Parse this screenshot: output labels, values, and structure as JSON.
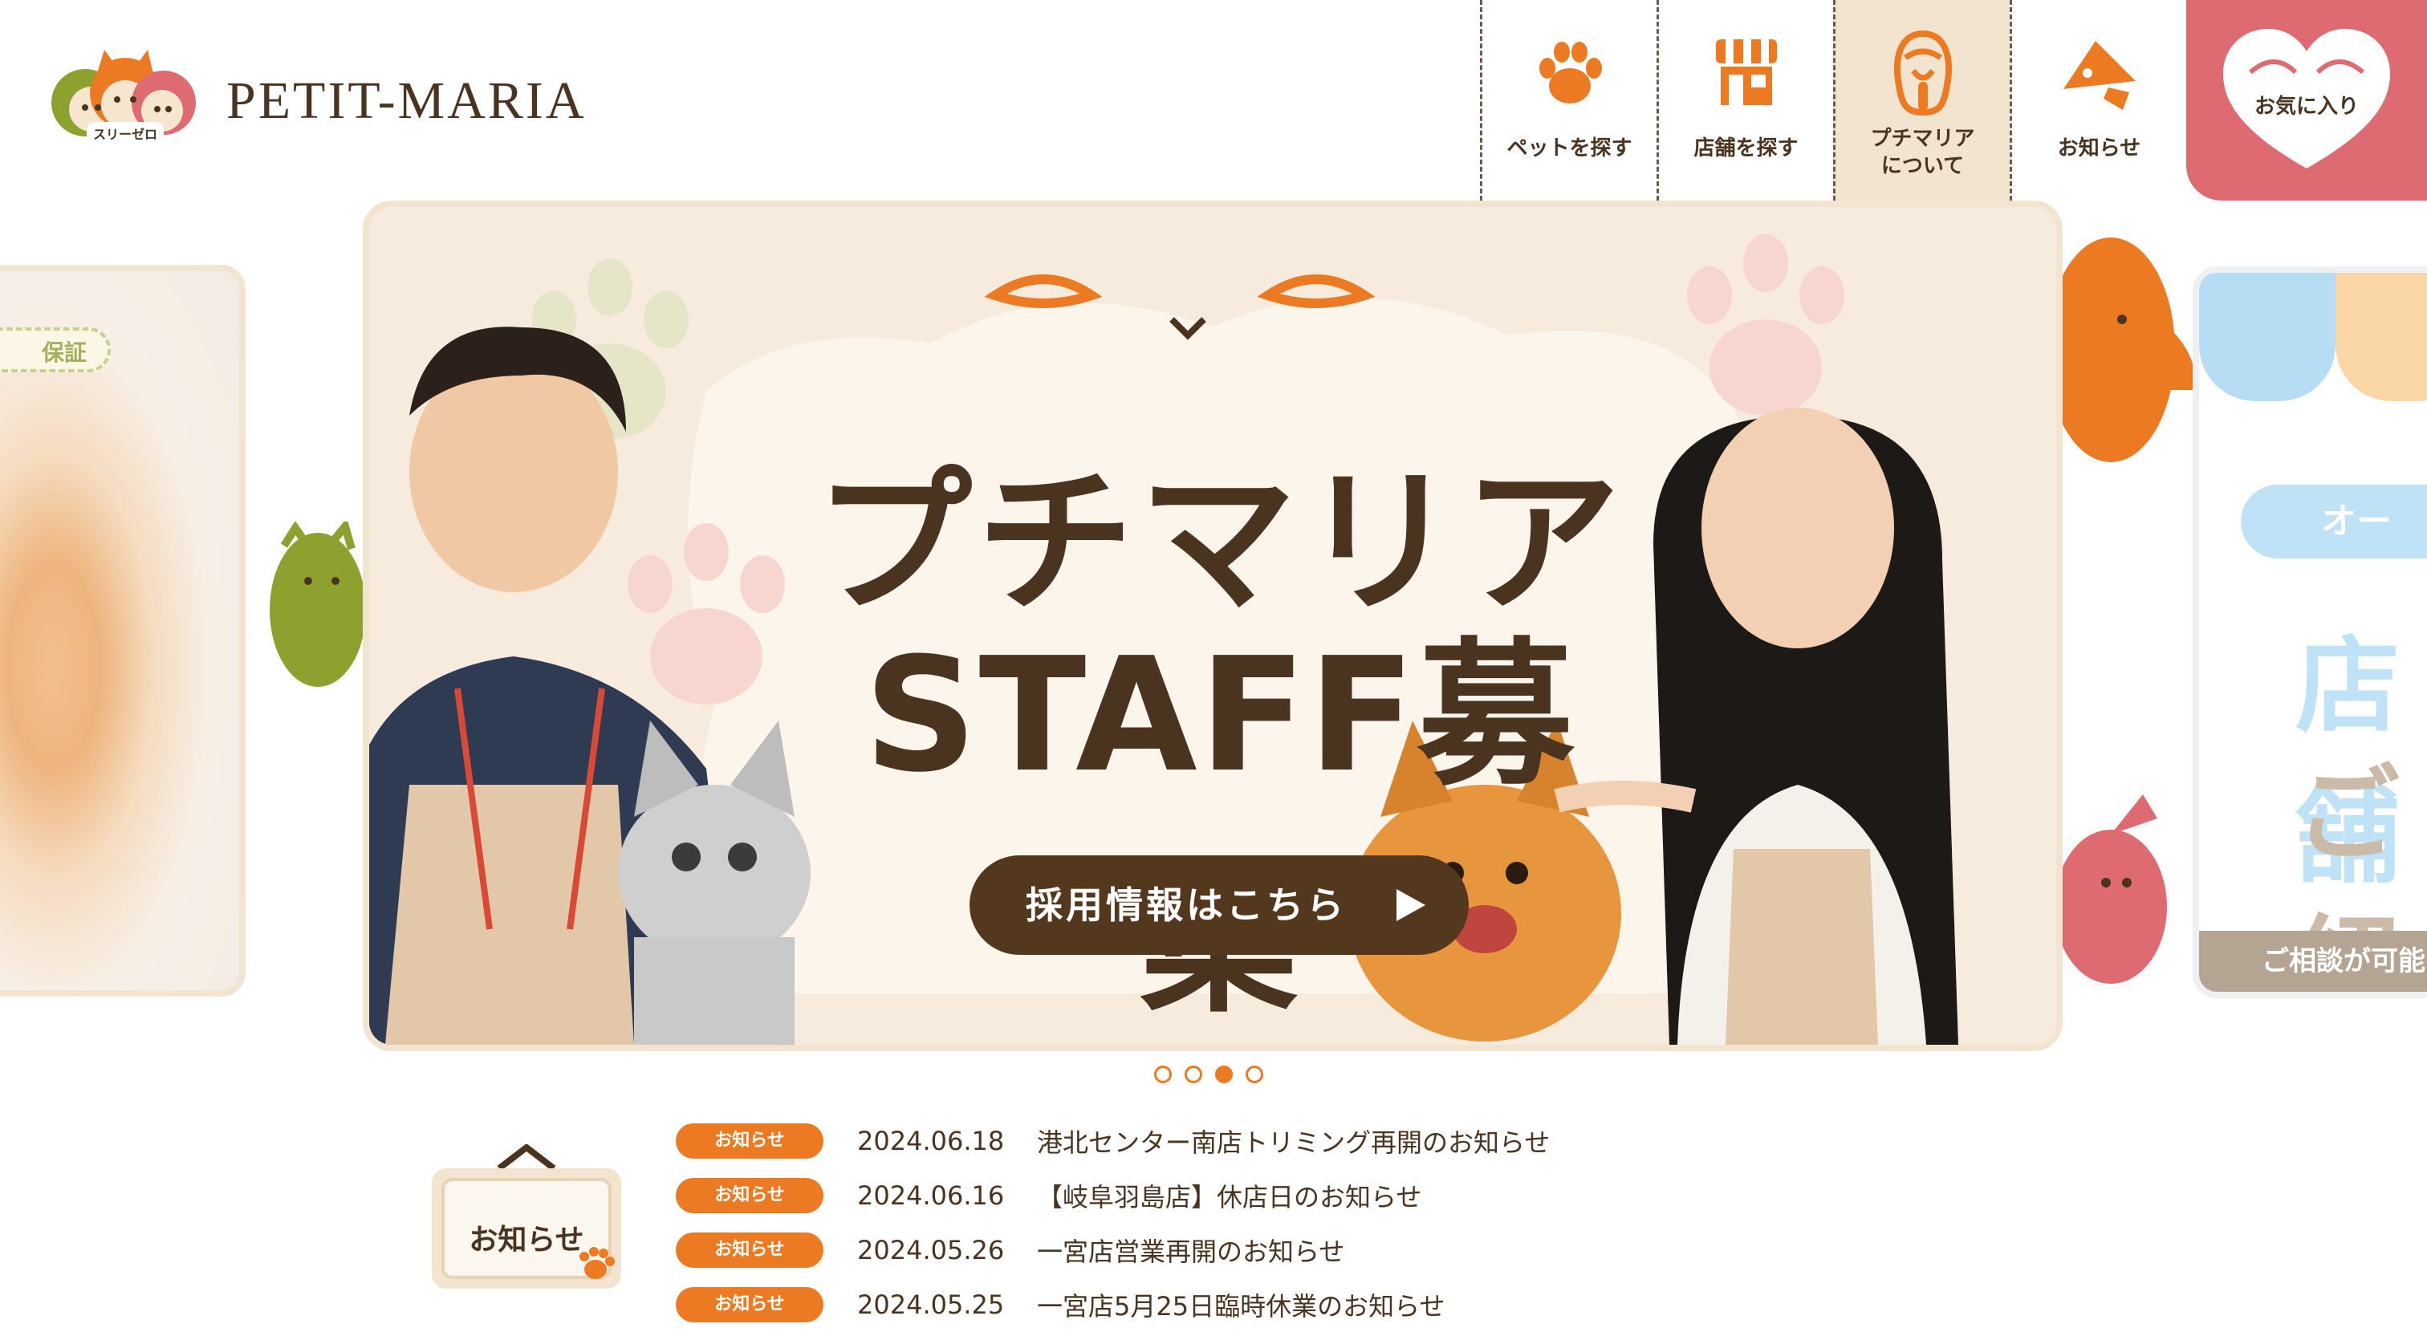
{
  "header": {
    "logo_text": "PETIT-MARIA",
    "logo_sub": "スリーゼロ",
    "nav": [
      {
        "label": "ペットを探す",
        "icon": "paw-icon"
      },
      {
        "label": "店舗を探す",
        "icon": "store-icon"
      },
      {
        "label": "プチマリア\nについて",
        "icon": "mascot-icon"
      },
      {
        "label": "お知らせ",
        "icon": "megaphone-icon"
      }
    ],
    "favorite_label": "お気に入り"
  },
  "left_card": {
    "ribbon": "保証"
  },
  "right_card": {
    "pill": "オー",
    "big1": "店舗",
    "big2": "ご紹",
    "bar": "ご相談が可能"
  },
  "banner": {
    "title_line1": "プチマリア",
    "title_line2": "STAFF募集",
    "cta_label": "採用情報はこちら"
  },
  "carousel": {
    "dot_count": 4,
    "active_index": 2
  },
  "news": {
    "sign_label": "お知らせ",
    "items": [
      {
        "badge": "お知らせ",
        "date": "2024.06.18",
        "title": "港北センター南店トリミング再開のお知らせ"
      },
      {
        "badge": "お知らせ",
        "date": "2024.06.16",
        "title": "【岐阜羽島店】休店日のお知らせ"
      },
      {
        "badge": "お知らせ",
        "date": "2024.05.26",
        "title": "一宮店営業再開のお知らせ"
      },
      {
        "badge": "お知らせ",
        "date": "2024.05.25",
        "title": "一宮店5月25日臨時休業のお知らせ"
      }
    ]
  },
  "colors": {
    "accent": "#ec7a22",
    "brown": "#4a3420",
    "favorite": "#df6b72",
    "cream": "#f3e4cf"
  }
}
